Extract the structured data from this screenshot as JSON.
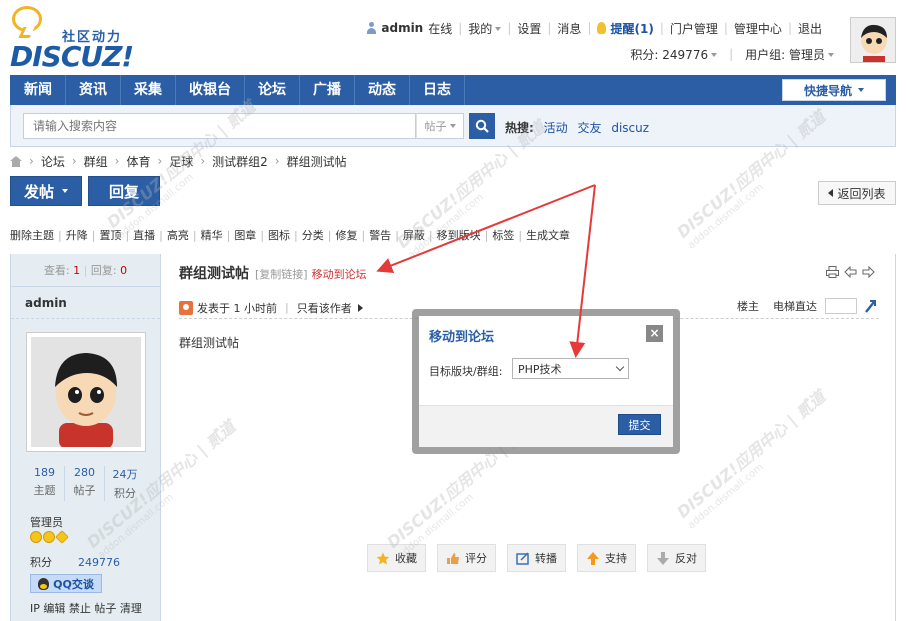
{
  "brand": {
    "slogan": "社区动力",
    "wordmark": "DISCUZ!"
  },
  "user_bar": {
    "username": "admin",
    "status": "在线",
    "links": [
      "我的",
      "设置",
      "消息"
    ],
    "remind": "提醒(1)",
    "admin_links": [
      "门户管理",
      "管理中心",
      "退出"
    ],
    "credits_label": "积分: 249776",
    "group_label": "用户组: 管理员"
  },
  "nav": {
    "items": [
      "新闻",
      "资讯",
      "采集",
      "收银台",
      "论坛",
      "广播",
      "动态",
      "日志"
    ],
    "quick_nav": "快捷导航"
  },
  "search": {
    "placeholder": "请输入搜索内容",
    "type": "帖子",
    "hot_label": "热搜:",
    "hot_words": [
      "活动",
      "交友",
      "discuz"
    ]
  },
  "breadcrumb": [
    "论坛",
    "群组",
    "体育",
    "足球",
    "测试群组2",
    "群组测试帖"
  ],
  "buttons": {
    "post": "发帖",
    "reply": "回复",
    "back": "返回列表"
  },
  "mod_tools": [
    "删除主题",
    "升降",
    "置顶",
    "直播",
    "高亮",
    "精华",
    "图章",
    "图标",
    "分类",
    "修复",
    "警告",
    "屏蔽",
    "移到版块",
    "标签",
    "生成文章"
  ],
  "sidebar": {
    "views_label": "查看:",
    "views": "1",
    "replies_label": "回复:",
    "replies": "0",
    "author": "admin",
    "stats": [
      {
        "value": "189",
        "label": "主题"
      },
      {
        "value": "280",
        "label": "帖子"
      },
      {
        "value": "24万",
        "label": "积分"
      }
    ],
    "group": "管理员",
    "points_label": "积分",
    "points": "249776",
    "qq": "QQ交谈",
    "admin_links": "IP 编辑 禁止 帖子 清理"
  },
  "post": {
    "title": "群组测试帖",
    "copy_link": "[复制链接]",
    "move_link": "移动到论坛",
    "posted": "发表于 1 小时前",
    "only_author": "只看该作者",
    "floor_label": "楼主",
    "jump_label": "电梯直达",
    "body": "群组测试帖",
    "actions": [
      "收藏",
      "评分",
      "转播",
      "支持",
      "反对"
    ]
  },
  "modal": {
    "title": "移动到论坛",
    "close": "×",
    "field_label": "目标版块/群组:",
    "selected": "PHP技术",
    "submit": "提交"
  },
  "watermark": {
    "text": "DISCUZ!应用中心 | 贰道",
    "sub": "addon.dismall.com"
  },
  "colors": {
    "brand_blue": "#2b5ea5",
    "arrow_red": "#e53a3a",
    "sidebar_bg": "#e5edf2"
  }
}
